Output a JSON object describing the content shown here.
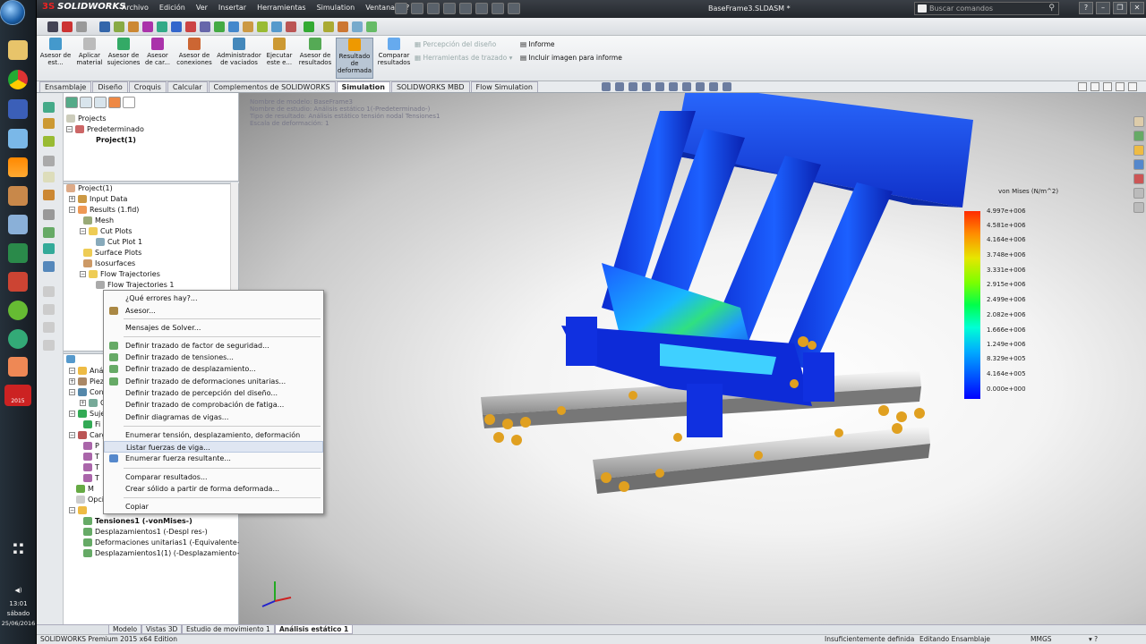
{
  "taskbar": {
    "time": "13:01",
    "day": "sábado",
    "date": "25/06/2016",
    "icons": [
      "chrome-icon",
      "folder-icon",
      "word-icon",
      "vlc-icon",
      "sublime-icon",
      "calculator-icon",
      "excel-icon",
      "ccleaner-icon",
      "utorrent-icon",
      "camtasia-icon",
      "office-icon",
      "solidworks-icon"
    ],
    "solidworks_badge": "2015"
  },
  "titlebar": {
    "app": "SOLIDWORKS",
    "menu": [
      "Archivo",
      "Edición",
      "Ver",
      "Insertar",
      "Herramientas",
      "Simulation",
      "Ventana",
      "?"
    ],
    "doc_title": "BaseFrame3.SLDASM *",
    "search_placeholder": "Buscar comandos"
  },
  "ribbon": {
    "buttons": [
      {
        "label": "Asesor de est..."
      },
      {
        "label": "Aplicar material"
      },
      {
        "label": "Asesor de sujeciones"
      },
      {
        "label": "Asesor de car..."
      },
      {
        "label": "Asesor de conexiones"
      },
      {
        "label": "Administrador de vaciados"
      },
      {
        "label": "Ejecutar este e..."
      },
      {
        "label": "Asesor de resultados"
      },
      {
        "label": "Resultado de deformada"
      },
      {
        "label": "Comparar resultados"
      }
    ],
    "small": {
      "percepcion": "Percepción del diseño",
      "trazado": "Herramientas de trazado",
      "informe": "Informe",
      "incluir": "Incluir imagen para informe"
    }
  },
  "tabs": [
    "Ensamblaje",
    "Diseño",
    "Croquis",
    "Calcular",
    "Complementos de SOLIDWORKS",
    "Simulation",
    "SOLIDWORKS MBD",
    "Flow Simulation"
  ],
  "active_tab": "Simulation",
  "tree_top": {
    "projects": "Projects",
    "predeterminado": "Predeterminado",
    "project1": "Project(1)"
  },
  "tree_flow": {
    "root": "Project(1)",
    "input": "Input Data",
    "results": "Results (1.fld)",
    "mesh": "Mesh",
    "cutplots": "Cut Plots",
    "cutplot1": "Cut Plot 1",
    "surface": "Surface Plots",
    "iso": "Isosurfaces",
    "flowtraj": "Flow Trajectories",
    "flowtraj1": "Flow Trajectories 1"
  },
  "tree_sim_partial": {
    "analisis": "Análi",
    "piezas": "Pieza",
    "conex": "Cone",
    "c": "C",
    "sujec": "Sujec",
    "fi": "Fi",
    "cargas": "Carga",
    "p": "P",
    "t1": "T",
    "t2": "T",
    "t3": "T",
    "m": "M",
    "opc": "Opci"
  },
  "tree_results": [
    "Tensiones1 (-vonMises-)",
    "Desplazamientos1 (-Despl res-)",
    "Deformaciones unitarias1 (-Equivalente-)",
    "Desplazamientos1(1) (-Desplazamiento-)"
  ],
  "context_menu": {
    "items": [
      "¿Qué errores hay?...",
      "Asesor...",
      "Mensajes de Solver...",
      "Definir trazado de factor de seguridad...",
      "Definir trazado de tensiones...",
      "Definir trazado de desplazamiento...",
      "Definir trazado de deformaciones unitarias...",
      "Definir trazado de percepción del diseño...",
      "Definir trazado de comprobación de fatiga...",
      "Definir diagramas de vigas...",
      "Enumerar tensión, desplazamiento, deformación unitaria",
      "Listar fuerzas de viga...",
      "Enumerar fuerza resultante...",
      "Comparar resultados...",
      "Crear sólido a partir de forma deformada...",
      "Copiar"
    ],
    "highlighted": "Listar fuerzas de viga..."
  },
  "viewport": {
    "info": [
      "Nombre de modelo: BaseFrame3",
      "Nombre de estudio: Análisis estático 1(-Predeterminado-)",
      "Tipo de resultado: Análisis estático tensión nodal Tensiones1",
      "Escala de deformación: 1"
    ],
    "legend_title": "von Mises (N/m^2)",
    "legend_values": [
      "4.997e+006",
      "4.581e+006",
      "4.164e+006",
      "3.748e+006",
      "3.331e+006",
      "2.915e+006",
      "2.499e+006",
      "2.082e+006",
      "1.666e+006",
      "1.249e+006",
      "8.329e+005",
      "4.164e+005",
      "0.000e+000"
    ]
  },
  "bottom_tabs": [
    "Modelo",
    "Vistas 3D",
    "Estudio de movimiento 1",
    "Análisis estático 1"
  ],
  "active_bottom_tab": "Análisis estático 1",
  "status": {
    "edition": "SOLIDWORKS Premium 2015 x64 Edition",
    "defined": "Insuficientemente definida",
    "editing": "Editando Ensamblaje",
    "units": "MMGS"
  }
}
